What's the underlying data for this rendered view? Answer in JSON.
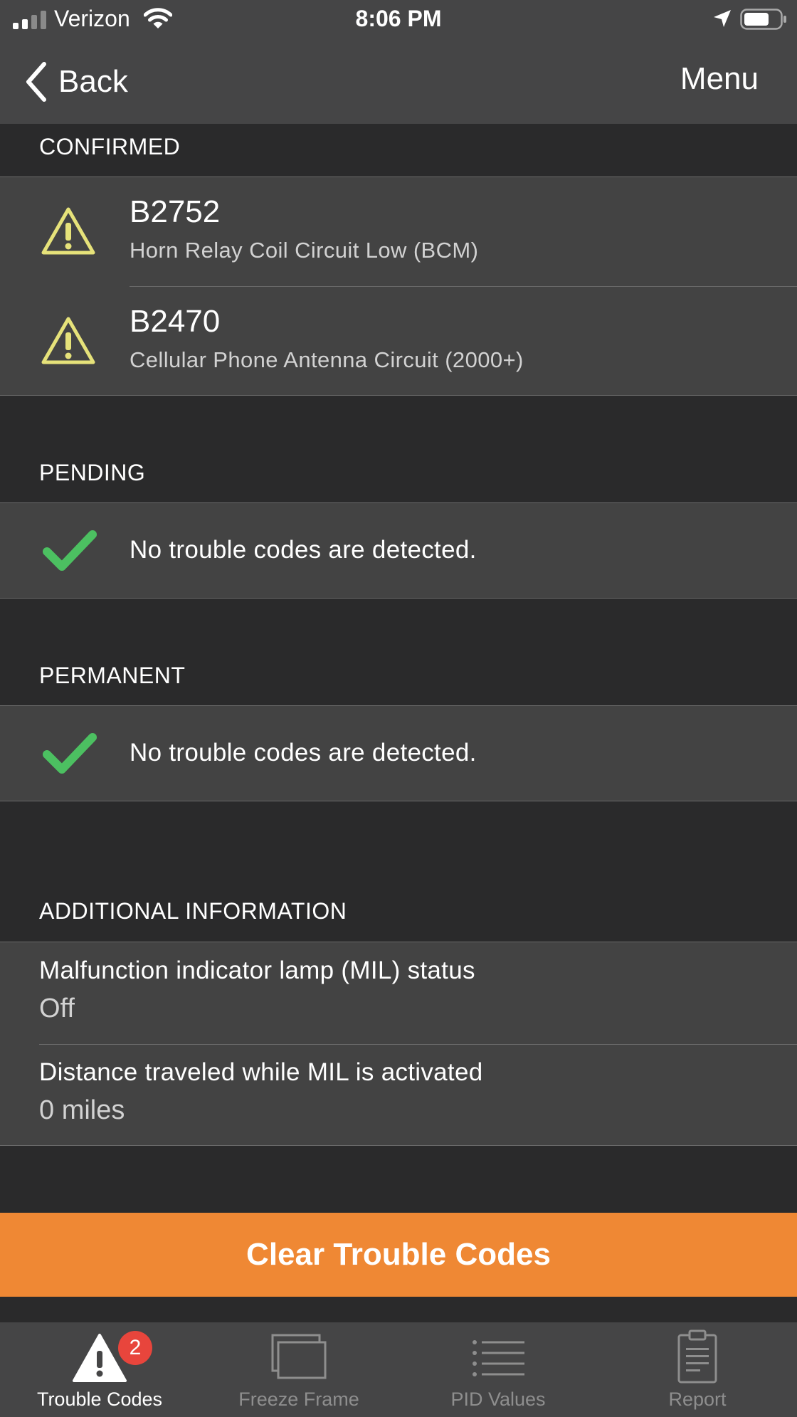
{
  "status_bar": {
    "carrier": "Verizon",
    "time": "8:06 PM"
  },
  "nav": {
    "back_label": "Back",
    "menu_label": "Menu"
  },
  "sections": {
    "confirmed": {
      "header": "CONFIRMED",
      "items": [
        {
          "code": "B2752",
          "description": "Horn Relay Coil Circuit Low (BCM)",
          "icon": "warning-icon"
        },
        {
          "code": "B2470",
          "description": "Cellular Phone Antenna Circuit (2000+)",
          "icon": "warning-icon"
        }
      ]
    },
    "pending": {
      "header": "PENDING",
      "message": "No trouble codes are detected.",
      "icon": "check-icon"
    },
    "permanent": {
      "header": "PERMANENT",
      "message": "No trouble codes are detected.",
      "icon": "check-icon"
    },
    "additional": {
      "header": "ADDITIONAL INFORMATION",
      "items": [
        {
          "label": "Malfunction indicator lamp (MIL) status",
          "value": "Off"
        },
        {
          "label": "Distance traveled while MIL is activated",
          "value": "0 miles"
        }
      ]
    }
  },
  "clear_button": {
    "label": "Clear Trouble Codes"
  },
  "tab_bar": {
    "tabs": [
      {
        "label": "Trouble Codes",
        "icon": "warning-icon",
        "active": true,
        "badge": "2"
      },
      {
        "label": "Freeze Frame",
        "icon": "frames-icon",
        "active": false
      },
      {
        "label": "PID Values",
        "icon": "list-icon",
        "active": false
      },
      {
        "label": "Report",
        "icon": "clipboard-icon",
        "active": false
      }
    ]
  },
  "colors": {
    "background": "#2a2a2b",
    "panel": "#434343",
    "bars": "#454546",
    "accent": "#ef8834",
    "warning": "#e6e27a",
    "check": "#4cc061",
    "badge": "#e8453c"
  }
}
